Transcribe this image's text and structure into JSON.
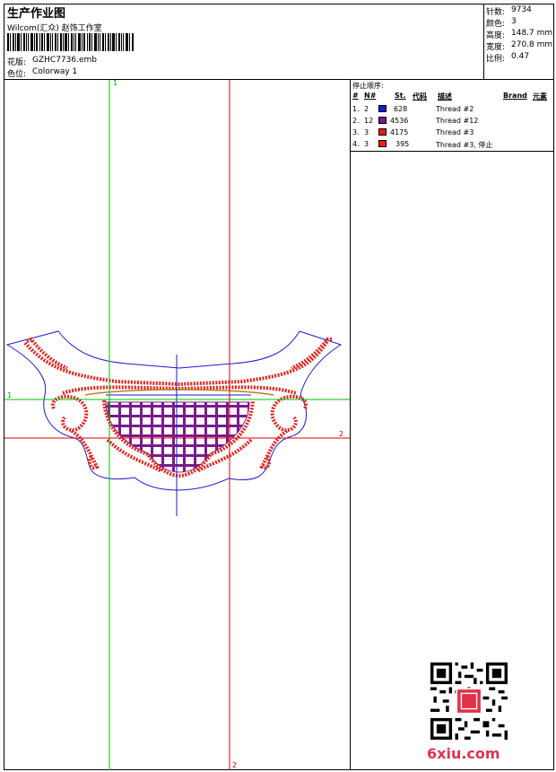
{
  "header": {
    "title": "生产作业图",
    "studio": "Wilcom(汇众) 赵饰工作室",
    "design_label": "花版:",
    "design_value": "GZHC7736.emb",
    "colorway_label": "色位:",
    "colorway_value": "Colorway 1"
  },
  "stats": {
    "stitches_label": "针数:",
    "stitches_value": "9734",
    "colors_label": "颜色:",
    "colors_value": "3",
    "height_label": "高度:",
    "height_value": "148.7 mm",
    "width_label": "宽度:",
    "width_value": "270.8 mm",
    "scale_label": "比例:",
    "scale_value": "0.47"
  },
  "thread_table": {
    "title": "停止顺序:",
    "headers": [
      "#",
      "N#",
      "St.",
      "代码",
      "描述",
      "Brand",
      "元素"
    ],
    "rows": [
      {
        "index": "1.",
        "needle": "2",
        "color": "#0020e0",
        "stitches": "628",
        "desc": "Thread #2"
      },
      {
        "index": "2.",
        "needle": "12",
        "color": "#7a1a8c",
        "stitches": "4536",
        "desc": "Thread #12"
      },
      {
        "index": "3.",
        "needle": "3",
        "color": "#e8201a",
        "stitches": "4175",
        "desc": "Thread #3"
      },
      {
        "index": "4.",
        "needle": "3",
        "color": "#e8201a",
        "stitches": "395",
        "desc": "Thread #3, 停止"
      }
    ]
  },
  "guides": {
    "v1_label": "1",
    "h1_label": "1",
    "h2_label": "2",
    "v2_label": "2",
    "v1_color": "#00c000",
    "v2_color": "#e00000"
  },
  "watermark": "6xiu.com"
}
